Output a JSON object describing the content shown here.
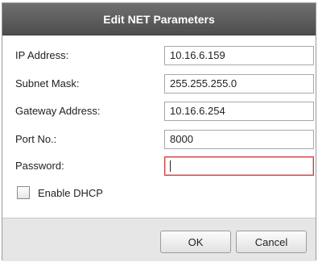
{
  "dialog": {
    "title": "Edit NET Parameters"
  },
  "fields": [
    {
      "label": "IP Address:",
      "value": "10.16.6.159"
    },
    {
      "label": "Subnet Mask:",
      "value": "255.255.255.0"
    },
    {
      "label": "Gateway Address:",
      "value": "10.16.6.254"
    },
    {
      "label": "Port No.:",
      "value": "8000"
    },
    {
      "label": "Password:",
      "value": ""
    }
  ],
  "dhcp": {
    "label": "Enable DHCP",
    "checked": false
  },
  "buttons": {
    "ok": "OK",
    "cancel": "Cancel"
  },
  "colors": {
    "title_bar": "#5a5a5a",
    "focus_border": "#d33a3a",
    "footer": "#e6e6e6"
  }
}
